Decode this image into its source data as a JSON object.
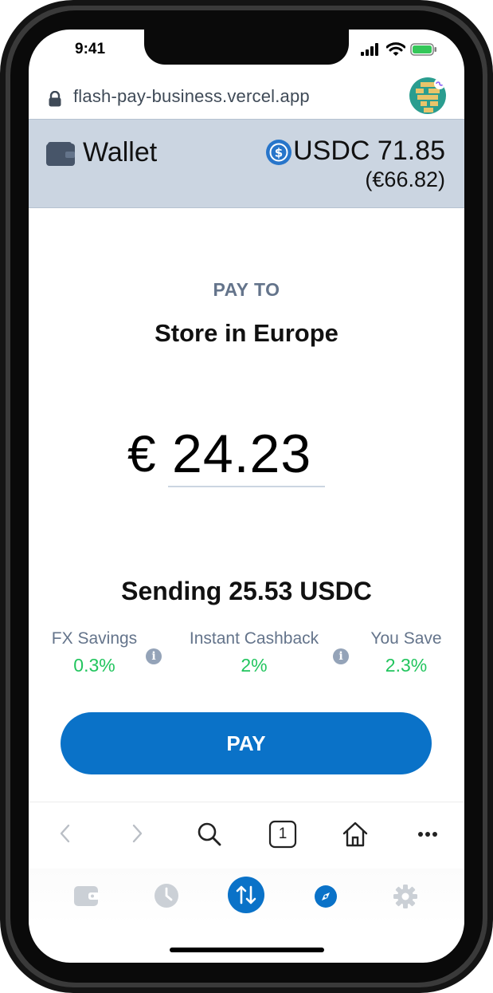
{
  "status_bar": {
    "time": "9:41"
  },
  "browser": {
    "url": "flash-pay-business.vercel.app"
  },
  "wallet_header": {
    "title": "Wallet",
    "balance": "USDC 71.85",
    "balance_fiat": "(€66.82)"
  },
  "payment": {
    "pay_to_label": "PAY TO",
    "merchant": "Store in Europe",
    "currency_symbol": "€",
    "amount": "24.23",
    "sending_text": "Sending 25.53 USDC"
  },
  "stats": [
    {
      "label": "FX Savings",
      "value": "0.3%"
    },
    {
      "label": "Instant Cashback",
      "value": "2%"
    },
    {
      "label": "You Save",
      "value": "2.3%"
    }
  ],
  "pay_button": {
    "label": "PAY"
  },
  "browser_toolbar": {
    "tab_count": "1"
  },
  "bottom_nav": {
    "items": [
      "wallet-icon",
      "clock-icon",
      "transfer-icon",
      "compass-icon",
      "gear-icon"
    ],
    "active": "transfer-icon"
  },
  "colors": {
    "header_bg": "#cbd5e1",
    "primary": "#0a72c8",
    "success": "#22c55e",
    "muted": "#64748b"
  }
}
